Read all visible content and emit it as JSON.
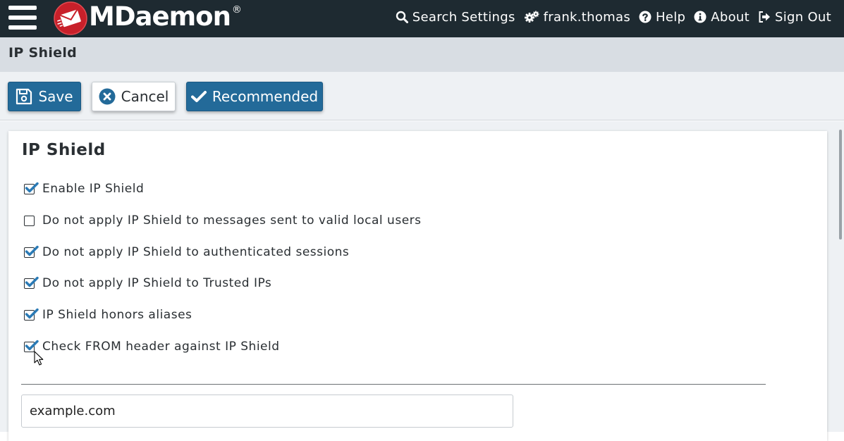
{
  "header": {
    "brand": "MDaemon",
    "registered_mark": "®",
    "nav": [
      {
        "label": "Search Settings",
        "icon": "search-icon"
      },
      {
        "label": "frank.thomas",
        "icon": "cogs-icon"
      },
      {
        "label": "Help",
        "icon": "question-circle-icon"
      },
      {
        "label": "About",
        "icon": "info-circle-icon"
      },
      {
        "label": "Sign Out",
        "icon": "sign-out-icon"
      }
    ]
  },
  "page": {
    "title": "IP Shield"
  },
  "toolbar": {
    "save_label": "Save",
    "cancel_label": "Cancel",
    "recommended_label": "Recommended"
  },
  "panel": {
    "title": "IP Shield",
    "options": [
      {
        "label": "Enable IP Shield",
        "checked": true
      },
      {
        "label": "Do not apply IP Shield to messages sent to valid local users",
        "checked": false
      },
      {
        "label": "Do not apply IP Shield to authenticated sessions",
        "checked": true
      },
      {
        "label": "Do not apply IP Shield to Trusted IPs",
        "checked": true
      },
      {
        "label": "IP Shield honors aliases",
        "checked": true
      },
      {
        "label": "Check FROM header against IP Shield",
        "checked": true
      }
    ],
    "domain_input_value": "example.com"
  },
  "colors": {
    "topbar": "#1e2a31",
    "primary_button": "#236a99",
    "check": "#2a7ab5",
    "title_band": "#d8dde3",
    "toolbar": "#eef1f4"
  }
}
